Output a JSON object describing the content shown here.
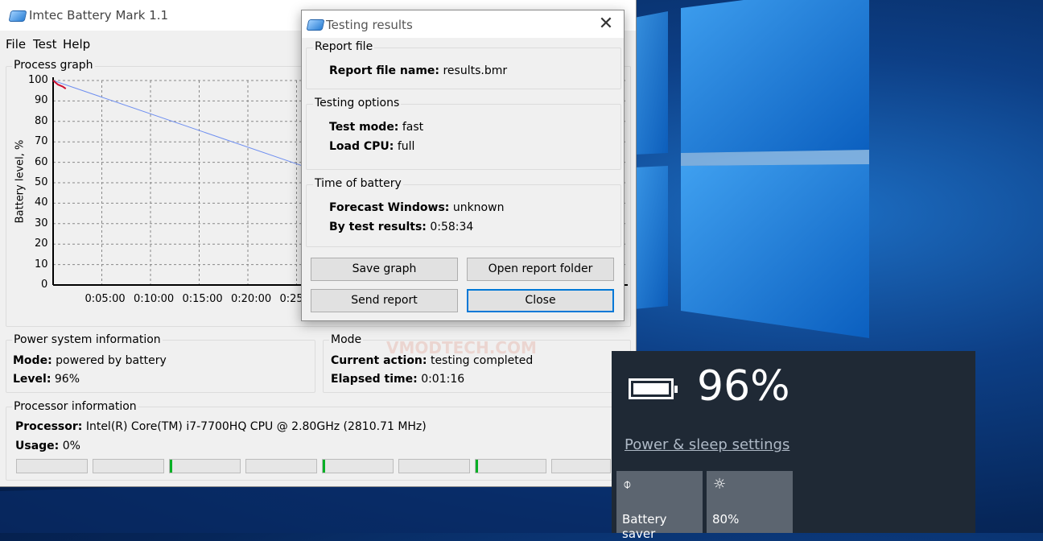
{
  "app": {
    "title": "Imtec Battery Mark 1.1",
    "menu": [
      "File",
      "Test",
      "Help"
    ],
    "graph": {
      "label": "Process graph",
      "ylabel": "Battery level, %",
      "yticks": [
        "100",
        "90",
        "80",
        "70",
        "60",
        "50",
        "40",
        "30",
        "20",
        "10",
        "0"
      ],
      "xticks": [
        "0:05:00",
        "0:10:00",
        "0:15:00",
        "0:20:00",
        "0:25"
      ]
    },
    "power": {
      "label": "Power system information",
      "mode_key": "Mode:",
      "mode_val": "powered by battery",
      "level_key": "Level:",
      "level_val": "96%"
    },
    "mode": {
      "label": "Mode",
      "action_key": "Current action:",
      "action_val": "testing completed",
      "elapsed_key": "Elapsed time:",
      "elapsed_val": "0:01:16"
    },
    "processor": {
      "label": "Processor information",
      "proc_key": "Processor:",
      "proc_val": "Intel(R) Core(TM) i7-7700HQ CPU @ 2.80GHz  (2810.71 MHz)",
      "usage_key": "Usage:",
      "usage_val": "0%"
    }
  },
  "chart_data": {
    "type": "line",
    "title": "",
    "xlabel": "",
    "ylabel": "Battery level, %",
    "ylim": [
      0,
      100
    ],
    "series": [
      {
        "values_x_minutes": [
          0,
          27
        ],
        "values_y": [
          100,
          56
        ],
        "color": "#6f8ff0"
      },
      {
        "values_x_minutes": [
          0,
          0.5,
          1,
          1.3
        ],
        "values_y": [
          100,
          98,
          97,
          96
        ],
        "color": "#d01030"
      }
    ],
    "grid": true
  },
  "dialog": {
    "title": "Testing results",
    "report": {
      "label": "Report file",
      "name_key": "Report file name:",
      "name_val": "results.bmr"
    },
    "options": {
      "label": "Testing options",
      "mode_key": "Test mode:",
      "mode_val": "fast",
      "cpu_key": "Load CPU:",
      "cpu_val": "full"
    },
    "time": {
      "label": "Time of battery",
      "forecast_key": "Forecast Windows:",
      "forecast_val": "unknown",
      "result_key": "By test results:",
      "result_val": "0:58:34"
    },
    "buttons": {
      "save_graph": "Save graph",
      "open_folder": "Open report folder",
      "send_report": "Send report",
      "close": "Close"
    }
  },
  "flyout": {
    "percent": "96%",
    "settings_link": "Power & sleep settings",
    "tiles": [
      {
        "label": "Battery saver",
        "icon": "leaf-icon"
      },
      {
        "label": "80%",
        "icon": "brightness-icon"
      }
    ]
  },
  "watermark": "VMODTECH.COM"
}
